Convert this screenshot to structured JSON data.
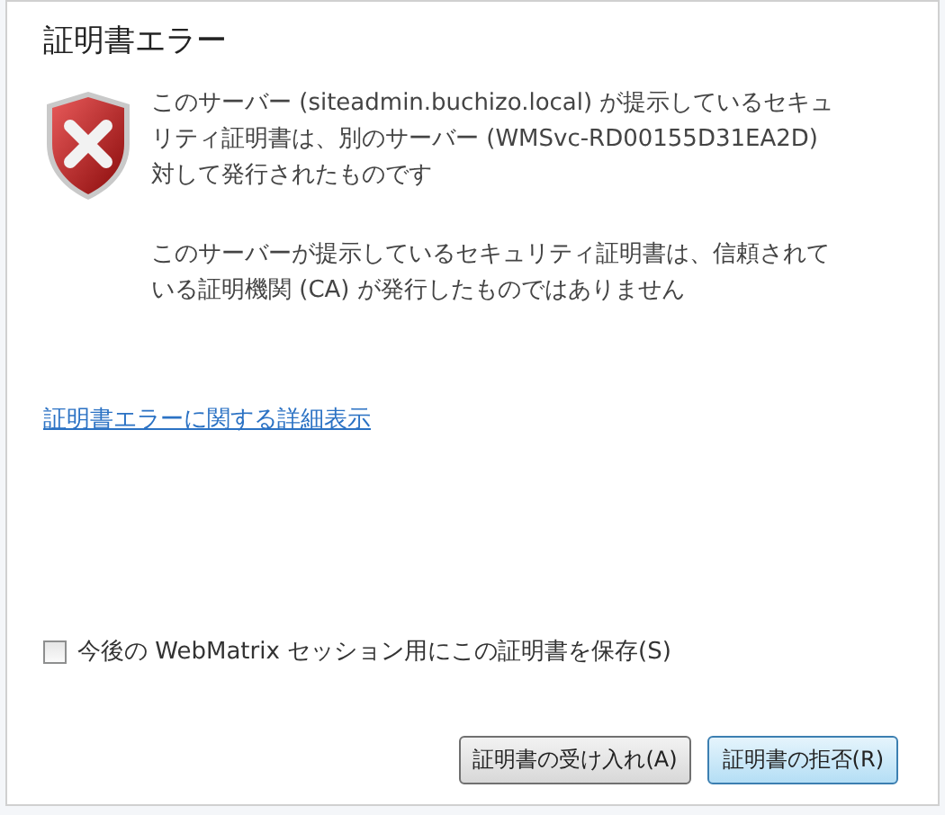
{
  "dialog": {
    "title": "証明書エラー"
  },
  "messages": [
    {
      "lines": [
        "このサーバー (siteadmin.buchizo.local) が提示しているセキュ",
        "リティ証明書は、別のサーバー (WMSvc-RD00155D31EA2D)",
        "対して発行されたものです"
      ]
    },
    {
      "lines": [
        "このサーバーが提示しているセキュリティ証明書は、信頼されて",
        "いる証明機関 (CA) が発行したものではありません"
      ]
    }
  ],
  "details_link": "証明書エラーに関する詳細表示",
  "save_option": {
    "label": "今後の WebMatrix セッション用にこの証明書を保存(S)",
    "checked": false
  },
  "buttons": [
    {
      "label": "証明書の受け入れ(A)",
      "selected": false
    },
    {
      "label": "証明書の拒否(R)",
      "selected": true
    }
  ]
}
